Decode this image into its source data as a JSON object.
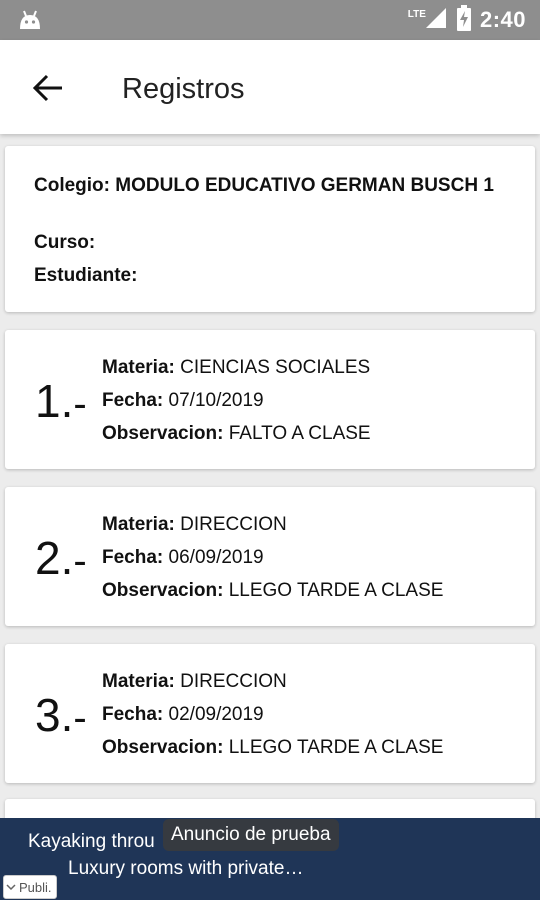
{
  "status_bar": {
    "network": "LTE",
    "time": "2:40",
    "icons": [
      "android-icon",
      "signal-icon",
      "battery-icon"
    ]
  },
  "app_bar": {
    "title": "Registros",
    "back_icon": "arrow-left-icon"
  },
  "school": {
    "colegio_label": "Colegio:",
    "colegio_value": "MODULO EDUCATIVO GERMAN BUSCH 1",
    "curso_label": "Curso:",
    "curso_value": "",
    "estudiante_label": "Estudiante:",
    "estudiante_value": ""
  },
  "labels": {
    "materia": "Materia:",
    "fecha": "Fecha:",
    "observacion": "Observacion:"
  },
  "records": [
    {
      "number": "1.",
      "suffix": "-",
      "materia": "CIENCIAS SOCIALES",
      "fecha": "07/10/2019",
      "observacion": "FALTO A CLASE"
    },
    {
      "number": "2.",
      "suffix": "-",
      "materia": "DIRECCION",
      "fecha": "06/09/2019",
      "observacion": "LLEGO TARDE A CLASE"
    },
    {
      "number": "3.",
      "suffix": "-",
      "materia": "DIRECCION",
      "fecha": "02/09/2019",
      "observacion": "LLEGO TARDE A CLASE"
    }
  ],
  "ad": {
    "line1": "Kayaking throu",
    "line2": "Luxury rooms with private…",
    "tooltip": "Anuncio de prueba",
    "publi_label": "Publi."
  },
  "colors": {
    "status_bar": "#8e8e8e",
    "background": "#ececec",
    "ad_background": "#1f3557"
  }
}
